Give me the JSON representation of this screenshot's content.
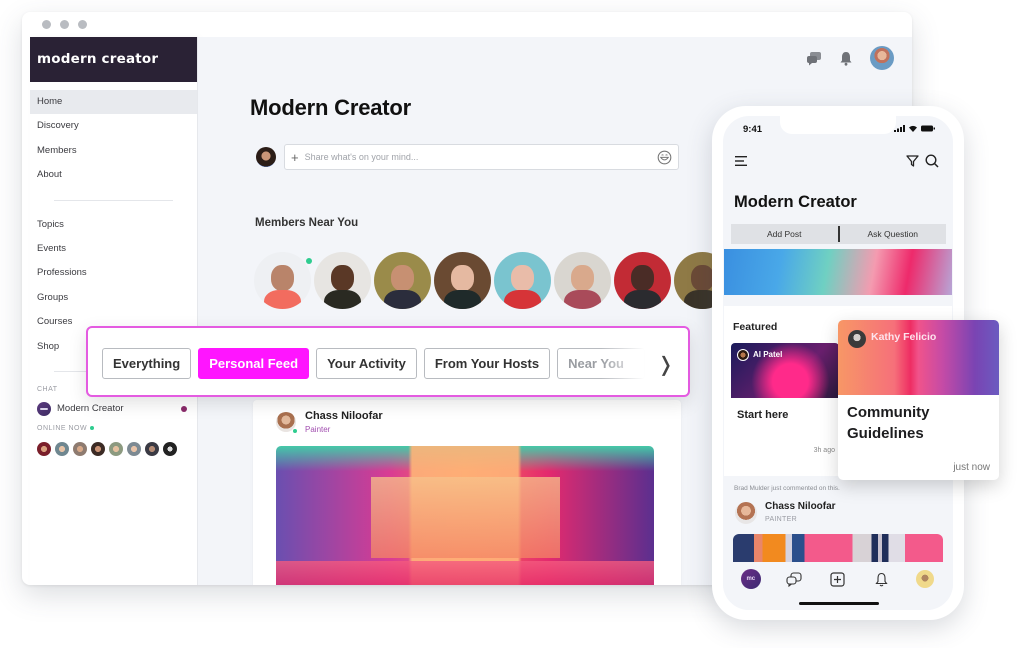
{
  "desktop": {
    "brand": "modern creator",
    "nav": {
      "primary": [
        "Home",
        "Discovery",
        "Members",
        "About"
      ],
      "secondary": [
        "Topics",
        "Events",
        "Professions",
        "Groups",
        "Courses",
        "Shop"
      ],
      "active": "Home"
    },
    "chat": {
      "label": "CHAT",
      "items": [
        {
          "name": "Modern Creator",
          "unread": true
        }
      ]
    },
    "online": {
      "label": "ONLINE NOW",
      "avatar_count": 8
    },
    "topbar_icons": [
      "messages-icon",
      "bell-icon",
      "user-avatar"
    ],
    "page_title": "Modern Creator",
    "composer": {
      "placeholder": "Share what's on your mind..."
    },
    "members_section": {
      "title": "Members Near You",
      "member_count": 8
    },
    "post": {
      "author": "Chass Niloofar",
      "role": "Painter"
    }
  },
  "filter_bar": {
    "chips": [
      {
        "label": "Everything",
        "active": false
      },
      {
        "label": "Personal Feed",
        "active": true
      },
      {
        "label": "Your Activity",
        "active": false
      },
      {
        "label": "From Your Hosts",
        "active": false
      },
      {
        "label": "Near You",
        "active": false
      }
    ],
    "accent_color": "#ff15ff"
  },
  "phone": {
    "status_time": "9:41",
    "title": "Modern Creator",
    "actions": [
      "Add Post",
      "Ask Question"
    ],
    "featured_label": "Featured",
    "featured_card": {
      "author": "Al Patel",
      "title": "Start here",
      "time": "3h ago"
    },
    "comment_note": "Brad Mulder just commented on this.",
    "post": {
      "author": "Chass Niloofar",
      "role": "PAINTER"
    },
    "tabbar": [
      "home-brand",
      "chat",
      "add",
      "notifications",
      "profile"
    ],
    "brand_mark": "mc"
  },
  "community_card": {
    "author": "Kathy Felicio",
    "title": "Community Guidelines",
    "time": "just now"
  }
}
